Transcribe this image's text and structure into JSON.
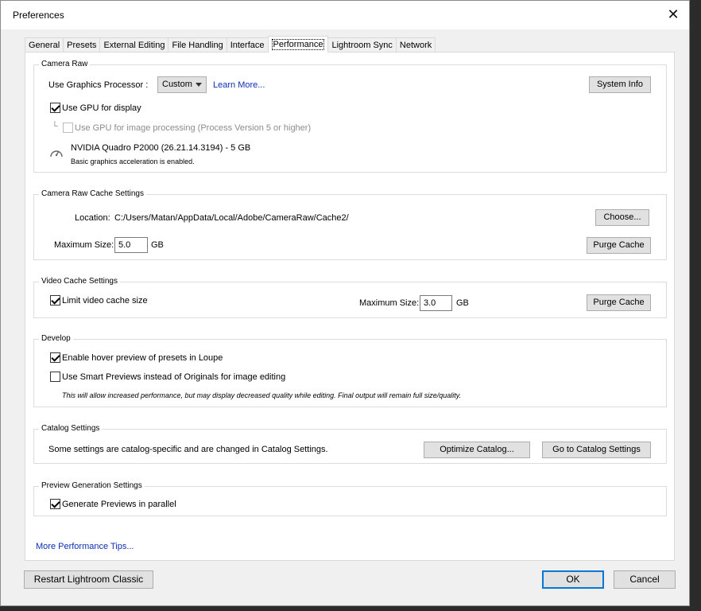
{
  "window": {
    "title": "Preferences"
  },
  "tabs": [
    "General",
    "Presets",
    "External Editing",
    "File Handling",
    "Interface",
    "Performance",
    "Lightroom Sync",
    "Network"
  ],
  "active_tab": "Performance",
  "camera_raw": {
    "group_label": "Camera Raw",
    "gpu_label": "Use Graphics Processor :",
    "gpu_value": "Custom",
    "learn_more": "Learn More...",
    "system_info": "System Info",
    "use_gpu_display": "Use GPU for display",
    "use_gpu_display_checked": true,
    "tree_glyph": "└",
    "use_gpu_processing": "Use GPU for image processing (Process Version 5 or higher)",
    "use_gpu_processing_checked": false,
    "gpu_name": "NVIDIA Quadro P2000 (26.21.14.3194) - 5 GB",
    "gpu_status": "Basic graphics acceleration is enabled."
  },
  "cache": {
    "group_label": "Camera Raw Cache Settings",
    "location_label": "Location:",
    "location_value": "C:/Users/Matan/AppData/Local/Adobe/CameraRaw/Cache2/",
    "choose": "Choose...",
    "max_size_label": "Maximum Size:",
    "max_size_value": "5.0",
    "unit": "GB",
    "purge": "Purge Cache"
  },
  "video_cache": {
    "group_label": "Video Cache Settings",
    "limit_label": "Limit video cache size",
    "limit_checked": true,
    "max_size_label": "Maximum Size:",
    "max_size_value": "3.0",
    "unit": "GB",
    "purge": "Purge Cache"
  },
  "develop": {
    "group_label": "Develop",
    "hover_preview": "Enable hover preview of presets in Loupe",
    "hover_preview_checked": true,
    "smart_previews": "Use Smart Previews instead of Originals for image editing",
    "smart_previews_checked": false,
    "note": "This will allow increased performance, but may display decreased quality while editing. Final output will remain full size/quality."
  },
  "catalog": {
    "group_label": "Catalog Settings",
    "text": "Some settings are catalog-specific and are changed in Catalog Settings.",
    "optimize": "Optimize Catalog...",
    "goto": "Go to Catalog Settings"
  },
  "preview_gen": {
    "group_label": "Preview Generation Settings",
    "parallel": "Generate Previews in parallel",
    "parallel_checked": true
  },
  "more_tips": "More Performance Tips...",
  "footer": {
    "restart": "Restart Lightroom Classic",
    "ok": "OK",
    "cancel": "Cancel"
  },
  "icons": {
    "close": "close-icon",
    "gauge": "gauge-icon",
    "dropdown": "chevron-down-icon",
    "checkmark": "checkmark-icon"
  }
}
